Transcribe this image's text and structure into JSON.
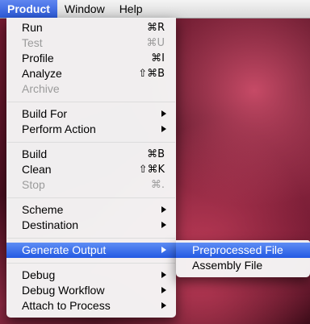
{
  "menubar": {
    "items": [
      {
        "label": "Product"
      },
      {
        "label": "Window"
      },
      {
        "label": "Help"
      }
    ]
  },
  "product_menu": {
    "items": [
      {
        "label": "Run",
        "shortcut": "⌘R",
        "disabled": false
      },
      {
        "label": "Test",
        "shortcut": "⌘U",
        "disabled": true
      },
      {
        "label": "Profile",
        "shortcut": "⌘I",
        "disabled": false
      },
      {
        "label": "Analyze",
        "shortcut": "⇧⌘B",
        "disabled": false
      },
      {
        "label": "Archive",
        "shortcut": "",
        "disabled": true
      },
      {
        "label": "Build For",
        "submenu": true
      },
      {
        "label": "Perform Action",
        "submenu": true
      },
      {
        "label": "Build",
        "shortcut": "⌘B",
        "disabled": false
      },
      {
        "label": "Clean",
        "shortcut": "⇧⌘K",
        "disabled": false
      },
      {
        "label": "Stop",
        "shortcut": "⌘.",
        "disabled": true
      },
      {
        "label": "Scheme",
        "submenu": true
      },
      {
        "label": "Destination",
        "submenu": true
      },
      {
        "label": "Generate Output",
        "submenu": true,
        "highlighted": true
      },
      {
        "label": "Debug",
        "submenu": true
      },
      {
        "label": "Debug Workflow",
        "submenu": true
      },
      {
        "label": "Attach to Process",
        "submenu": true
      }
    ]
  },
  "generate_output_submenu": {
    "items": [
      {
        "label": "Preprocessed File",
        "highlighted": true
      },
      {
        "label": "Assembly File"
      }
    ]
  },
  "colors": {
    "highlight": "#2c5ad8",
    "disabled_text": "#9b9b9b"
  }
}
